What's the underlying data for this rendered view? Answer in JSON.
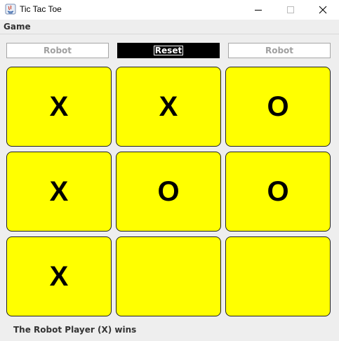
{
  "window": {
    "title": "Tic Tac Toe"
  },
  "menu": {
    "game": "Game"
  },
  "controls": {
    "left_label": "Robot",
    "reset_label": "Reset",
    "right_label": "Robot"
  },
  "board": {
    "cell_color": "#ffff00",
    "cells": [
      "X",
      "X",
      "O",
      "X",
      "O",
      "O",
      "X",
      "",
      ""
    ]
  },
  "status": {
    "text": "The Robot Player (X) wins"
  },
  "icons": [
    "java-app-icon",
    "minimize-icon",
    "maximize-icon",
    "close-icon"
  ]
}
